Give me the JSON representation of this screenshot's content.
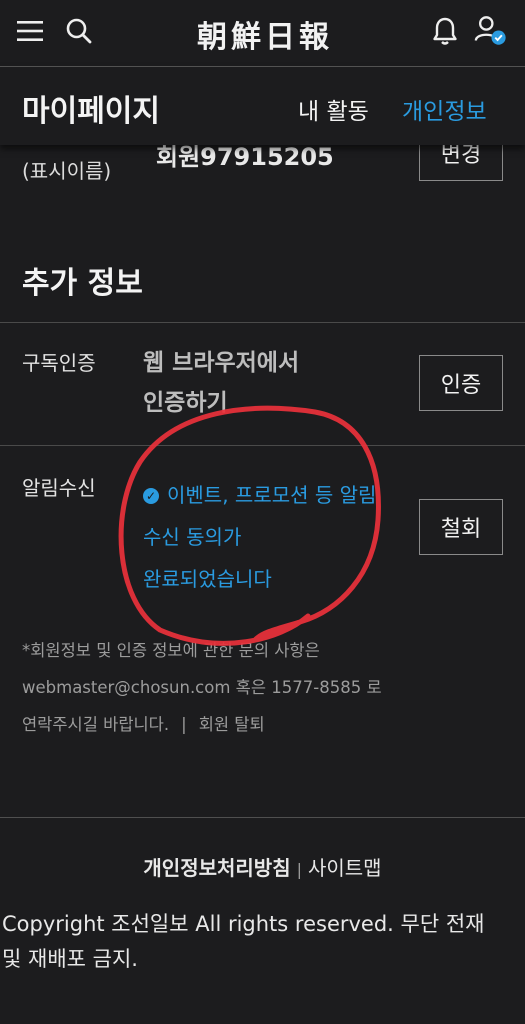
{
  "header": {
    "logo": "朝鮮日報",
    "icons": [
      "menu-icon",
      "search-icon",
      "bell-icon",
      "user-verified-icon"
    ]
  },
  "subheader": {
    "title": "마이페이지",
    "tabs": [
      {
        "label": "내 활동",
        "active": false
      },
      {
        "label": "개인정보",
        "active": true
      }
    ]
  },
  "nickname_row": {
    "label": "(표시이름)",
    "value": "회원97915205",
    "button": "변경"
  },
  "additional": {
    "title": "추가 정보",
    "subscription": {
      "label": "구독인증",
      "value_line1": "웹 브라우저에서",
      "value_line2": "인증하기",
      "button": "인증"
    },
    "notification": {
      "label": "알림수신",
      "line1": "이벤트, 프로모션 등 알림",
      "line2": "수신 동의가",
      "line3": "완료되었습니다",
      "button": "철회"
    }
  },
  "info": {
    "line1": "*회원정보 및 인증 정보에 관한 문의 사항은",
    "line2": "webmaster@chosun.com 혹은 1577-8585 로",
    "line3": "연락주시길 바랍니다.",
    "separator": "|",
    "withdraw": "회원 탈퇴"
  },
  "footer": {
    "privacy": "개인정보처리방침",
    "separator": "|",
    "sitemap": "사이트맵",
    "copyright_line1": "Copyright 조선일보 All rights reserved. 무단 전재",
    "copyright_line2": "및 재배포 금지."
  },
  "colors": {
    "background": "#1c1c1e",
    "accent": "#2a9be0",
    "annotation": "#e8303a"
  }
}
